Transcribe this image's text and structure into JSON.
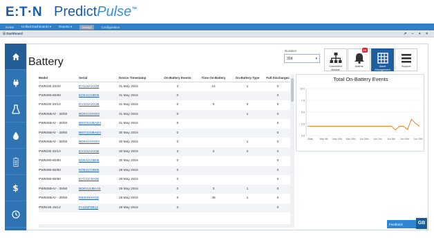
{
  "brand": {
    "company": "E:T·N",
    "product_main": "Predict",
    "product_accent": "Pulse",
    "tm": "™"
  },
  "nav": {
    "items": [
      "Home",
      "Unified Dashboards ▾",
      "Reports ▾",
      "ceasy3",
      "Configuration"
    ],
    "active_index": 3
  },
  "subbar": {
    "breadcrumb": "☰ Dashboard",
    "window_controls": "↗ – + ×"
  },
  "sidebar": {
    "icons": [
      "home-icon",
      "plug-icon",
      "flask-icon",
      "droplet-icon",
      "battery-icon",
      "dollar-icon",
      "clock-icon"
    ],
    "active_index": 0
  },
  "page": {
    "title": "Battery"
  },
  "duration": {
    "label": "Duration",
    "value": "30d"
  },
  "toolbar": {
    "connected": "Connected Module",
    "alarms": "Alarms",
    "alarms_badge": "10",
    "asset_management": "Asset Management",
    "support": "Support"
  },
  "table": {
    "columns": [
      "Model",
      "Serial",
      "Device Timestamp",
      "On-Battery Events",
      "Time On-Battery",
      "On-Battery Type",
      "Full Discharges"
    ],
    "rows": [
      [
        "PW9330 20/20",
        "EY124AXX30",
        "31 May 2016",
        "2",
        "21",
        "1",
        "0"
      ],
      [
        "PW9390-80/80",
        "ED041C0B05",
        "31 May 2016",
        "0",
        "",
        "",
        "0"
      ],
      [
        "PW9330 20/10",
        "EV431AXX36",
        "31 May 2016",
        "0",
        "0",
        "0",
        "0"
      ],
      [
        "PW9355HV - 30/50",
        "BD0214XXD3",
        "31 May 2016",
        "0",
        "",
        "1",
        "0"
      ],
      [
        "PW9355HV - 30/50",
        "BE0723JBAD4",
        "31 May 2016",
        "0",
        "",
        "",
        "0"
      ],
      [
        "PW9355HV - 30/50",
        "BE0723JBAD4",
        "30 May 2016",
        "0",
        "",
        "",
        "0"
      ],
      [
        "PW9355HV - 30/50",
        "BD0214XXD3",
        "30 May 2016",
        "0",
        "",
        "1",
        "0"
      ],
      [
        "PW9330 20/10",
        "EV431AXX36",
        "30 May 2016",
        "2",
        "0",
        "0",
        "0"
      ],
      [
        "PW9390-80/80",
        "ED041C0B05",
        "30 May 2016",
        "0",
        "",
        "",
        "0"
      ],
      [
        "PW9390-80/80",
        "ED041C0B05",
        "29 May 2016",
        "0",
        "",
        "",
        "0"
      ],
      [
        "PW9390-80/80",
        "EY121C6A06",
        "29 May 2016",
        "0",
        "",
        "",
        "0"
      ],
      [
        "PW9355HV - 30/50",
        "BD0213JBA15",
        "29 May 2016",
        "0",
        "3",
        "1",
        "0"
      ],
      [
        "PW9355HV - 30/50",
        "EB3049XX18",
        "29 May 2016",
        "0",
        "45",
        "1",
        "0"
      ],
      [
        "PW9155 15/12",
        "FA425F0B12",
        "28 May 2016",
        "0",
        "",
        "",
        "0"
      ]
    ]
  },
  "chart_data": {
    "type": "line",
    "title": "Total On-Battery Events",
    "y_ticks": [
      "0.0",
      "2.5",
      "5.0",
      "7.5",
      "10.0"
    ],
    "ylim": [
      0,
      10
    ],
    "x_ticks": [
      "2May",
      "May 8th",
      "May 14th",
      "May 20th",
      "Jun 26th",
      "Jun 2nd",
      "Jun 8th",
      "Jun 14th",
      "Jun 20th"
    ],
    "x_ticks_row2": [
      "",
      "",
      "",
      "",
      "",
      "",
      "",
      "",
      ""
    ],
    "series": [
      {
        "values": [
          2,
          2,
          2,
          2,
          2,
          2,
          2,
          2,
          2,
          2,
          2,
          2,
          2,
          2,
          2,
          2,
          2,
          2,
          2,
          2,
          2,
          2,
          1.2,
          2,
          2,
          1.3,
          3.5,
          2.6,
          2
        ]
      }
    ],
    "color": "#f0892a"
  },
  "footer": {
    "button_label": "Feedback",
    "logo_text": "GB"
  }
}
